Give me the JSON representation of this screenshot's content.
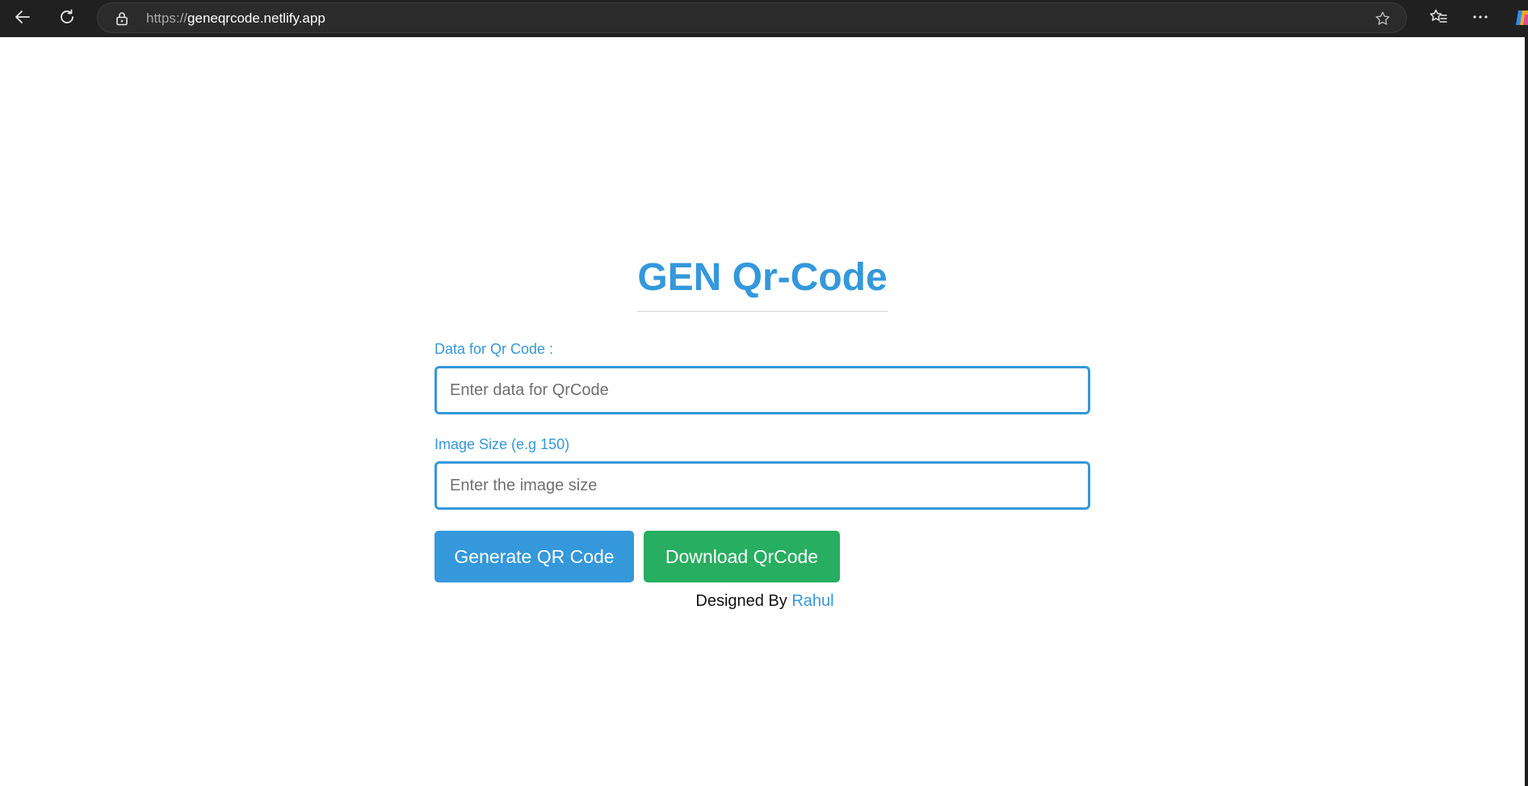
{
  "browser": {
    "url_scheme": "https://",
    "url_host": "geneqrcode.netlify.app"
  },
  "page": {
    "title": "GEN Qr-Code",
    "data_field": {
      "label": "Data for Qr Code :",
      "placeholder": "Enter data for QrCode",
      "value": ""
    },
    "size_field": {
      "label": "Image Size (e.g 150)",
      "placeholder": "Enter the image size",
      "value": ""
    },
    "buttons": {
      "generate": "Generate QR Code",
      "download": "Download QrCode"
    },
    "footer": {
      "prefix": "Designed By",
      "author": "Rahul"
    }
  },
  "colors": {
    "accent": "#3498db",
    "download": "#27ae60",
    "chrome": "#202020"
  },
  "icons": [
    "back-arrow-icon",
    "refresh-icon",
    "lock-icon",
    "star-icon",
    "favorites-icon",
    "more-icon",
    "copilot-icon"
  ]
}
